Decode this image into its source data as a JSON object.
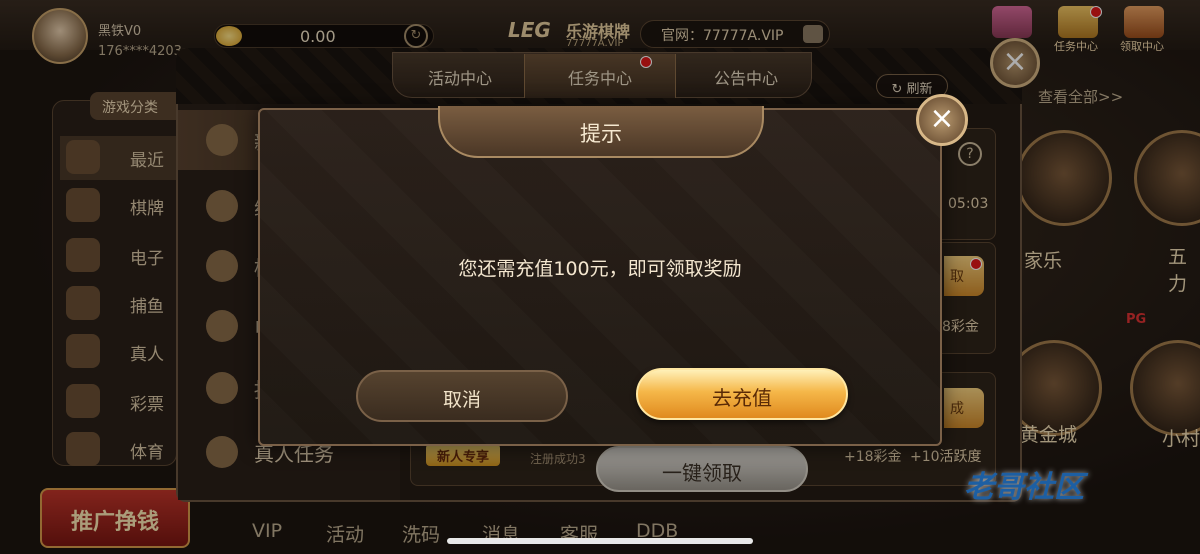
{
  "topbar": {
    "rank": "黑铁V0",
    "user_id": "176****4203",
    "balance": "0.00",
    "brand": "LEG",
    "brand_name": "乐游棋牌",
    "brand_site": "77777A.VIP",
    "official_site": "官网：77777A.VIP",
    "task_center_label": "任务中心",
    "claim_center_label": "领取中心"
  },
  "sidebar": {
    "category_label": "游戏分类",
    "items": [
      {
        "label": "最近"
      },
      {
        "label": "棋牌"
      },
      {
        "label": "电子"
      },
      {
        "label": "捕鱼"
      },
      {
        "label": "真人"
      },
      {
        "label": "彩票"
      },
      {
        "label": "体育"
      }
    ],
    "promo_label": "推广挣钱"
  },
  "bottom_nav": [
    "VIP",
    "活动",
    "洗码",
    "消息",
    "客服",
    "DDB"
  ],
  "lobby": {
    "see_all": "查看全部>>",
    "games": [
      "家乐",
      "五力",
      "黄金城",
      "小村"
    ],
    "pg_tag": "PG",
    "watermark": "老哥社区"
  },
  "activity": {
    "tabs": [
      {
        "label": "活动中心"
      },
      {
        "label": "任务中心"
      },
      {
        "label": "公告中心"
      }
    ],
    "refresh_label": "刷新",
    "left_items": [
      {
        "label": "新"
      },
      {
        "label": "综"
      },
      {
        "label": "棋"
      },
      {
        "label": "电"
      },
      {
        "label": "捕"
      },
      {
        "label": "真人任务"
      }
    ],
    "card_time": "05:03",
    "reward_1": "8彩金",
    "reward_2_cash": "+18彩金",
    "reward_2_activity": "+10活跃度",
    "new_user_tag": "新人专享",
    "register_text": "注册成功3",
    "claim_all": "一键领取",
    "gold_btn_1": "取",
    "gold_btn_2": "成"
  },
  "modal": {
    "title": "提示",
    "message": "您还需充值100元，即可领取奖励",
    "cancel_label": "取消",
    "recharge_label": "去充值"
  },
  "colors": {
    "accent_gold": "#f5b749",
    "panel_brown": "#2b211a",
    "red_dot": "#e01818"
  }
}
